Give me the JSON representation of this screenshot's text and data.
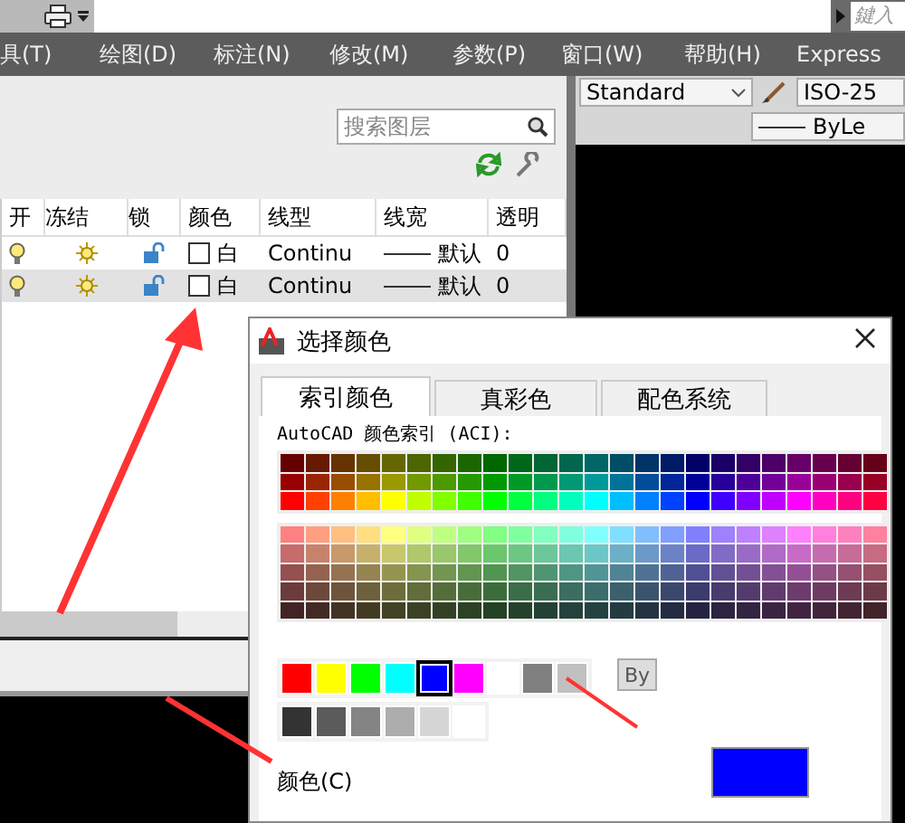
{
  "quick_access": {
    "search": {
      "placeholder": "鍵入"
    }
  },
  "menu_bar": [
    {
      "label": "具(T)"
    },
    {
      "label": "绘图(D)"
    },
    {
      "label": "标注(N)"
    },
    {
      "label": "修改(M)"
    },
    {
      "label": "参数(P)"
    },
    {
      "label": "窗口(W)"
    },
    {
      "label": "帮助(H)"
    },
    {
      "label": "Express"
    }
  ],
  "toolbar": {
    "text_style": "Standard",
    "dim_style": "ISO-25",
    "lineweight": "ByLe"
  },
  "layer_panel": {
    "search": {
      "placeholder": "搜索图层"
    },
    "columns": [
      "开",
      "冻结",
      "锁",
      "颜色",
      "线型",
      "线宽",
      "透明"
    ],
    "rows": [
      {
        "on": true,
        "frozen": false,
        "locked": false,
        "color": "#ffffff",
        "color_name": "白",
        "linetype": "Continu",
        "lineweight": "默认",
        "transparency": "0",
        "selected": false
      },
      {
        "on": true,
        "frozen": false,
        "locked": false,
        "color": "#ffffff",
        "color_name": "白",
        "linetype": "Continu",
        "lineweight": "默认",
        "transparency": "0",
        "selected": true
      }
    ]
  },
  "dialog": {
    "title": "选择颜色",
    "tabs": [
      {
        "label": "索引颜色",
        "selected": true
      },
      {
        "label": "真彩色",
        "selected": false
      },
      {
        "label": "配色系统",
        "selected": false
      }
    ],
    "palette_label": "AutoCAD 颜色索引 (ACI):",
    "standard_colors": [
      {
        "color": "#ff0000",
        "selected": false
      },
      {
        "color": "#ffff00",
        "selected": false
      },
      {
        "color": "#00ff00",
        "selected": false
      },
      {
        "color": "#00ffff",
        "selected": false
      },
      {
        "color": "#0000ff",
        "selected": true
      },
      {
        "color": "#ff00ff",
        "selected": false
      },
      {
        "color": "#ffffff",
        "selected": false
      },
      {
        "color": "#808080",
        "selected": false
      },
      {
        "color": "#c0c0c0",
        "selected": false
      }
    ],
    "gray_colors": [
      {
        "color": "#333333",
        "selected": false
      },
      {
        "color": "#5b5b5b",
        "selected": false
      },
      {
        "color": "#848484",
        "selected": false
      },
      {
        "color": "#adadad",
        "selected": false
      },
      {
        "color": "#d6d6d6",
        "selected": false
      },
      {
        "color": "#ffffff",
        "selected": false
      }
    ],
    "bylayer_button": "By",
    "color_label": "颜色(C)",
    "preview": {
      "color": "#0000ff"
    }
  }
}
